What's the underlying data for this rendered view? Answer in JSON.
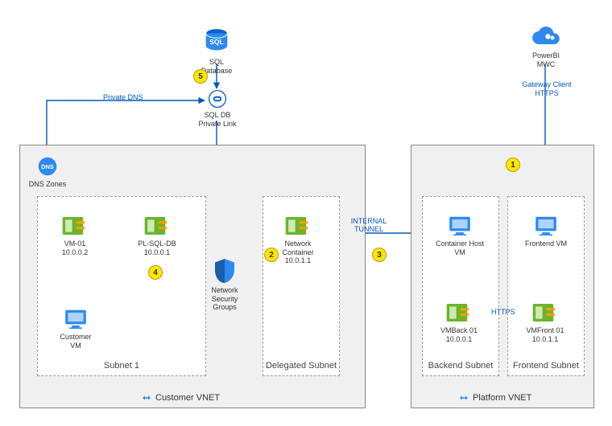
{
  "chart_data": {
    "type": "diagram",
    "title": "",
    "vnets": [
      {
        "name": "Customer VNET",
        "subnets": [
          {
            "name": "Subnet 1",
            "resources": [
              {
                "id": "vm01",
                "label": "VM-01",
                "ip": "10.0.0.2",
                "type": "nic"
              },
              {
                "id": "plsqldb",
                "label": "PL-SQL-DB",
                "ip": "10.0.0.1",
                "type": "nic"
              },
              {
                "id": "customervm",
                "label": "Customer VM",
                "type": "vm"
              }
            ]
          },
          {
            "name": "Delegated Subnet",
            "resources": [
              {
                "id": "netcontainer",
                "label": "Network Container",
                "ip": "10.0.1.1",
                "type": "nic"
              }
            ]
          }
        ],
        "extras": [
          {
            "id": "dns",
            "label": "DNS Zones",
            "type": "dns"
          },
          {
            "id": "nsg",
            "label": "Network Security Groups",
            "type": "nsg"
          }
        ]
      },
      {
        "name": "Platform VNET",
        "subnets": [
          {
            "name": "Backend Subnet",
            "resources": [
              {
                "id": "chost",
                "label": "Container Host VM",
                "type": "vm"
              },
              {
                "id": "vmback",
                "label": "VMBack 01",
                "ip": "10.0.0.1",
                "type": "nic"
              }
            ]
          },
          {
            "name": "Frontend Subnet",
            "resources": [
              {
                "id": "fvm",
                "label": "Frontend VM",
                "type": "vm"
              },
              {
                "id": "vmfront",
                "label": "VMFront 01",
                "ip": "10.0.1.1",
                "type": "nic"
              }
            ]
          }
        ]
      }
    ],
    "external": [
      {
        "id": "sqldb",
        "label": "SQL Database",
        "type": "sql"
      },
      {
        "id": "sqlpl",
        "label": "SQL DB Private Link",
        "type": "privatelink"
      },
      {
        "id": "pbi",
        "label": "PowerBI MWC",
        "type": "cloud"
      }
    ],
    "connections": [
      {
        "from": "pbi",
        "to": "fvm",
        "label": "Gateway Client HTTPS"
      },
      {
        "from": "netcontainer",
        "to": "chost",
        "label": "INTERNAL TUNNEL"
      },
      {
        "from": "vmfront",
        "to": "vmback",
        "label": "HTTPS"
      },
      {
        "from": "dns",
        "to": "sqlpl",
        "label": "Private DNS"
      },
      {
        "from": "dns",
        "to": "plsqldb",
        "label": ""
      },
      {
        "from": "vm01",
        "to": "customervm",
        "label": ""
      },
      {
        "from": "sqldb",
        "to": "sqlpl",
        "label": ""
      },
      {
        "from": "sqlpl",
        "to": "nsg_through",
        "label": ""
      },
      {
        "from": "nsg",
        "to": "plsqldb",
        "label": ""
      },
      {
        "from": "fvm",
        "to": "vmfront",
        "label": ""
      },
      {
        "from": "chost",
        "to": "vmback",
        "label": ""
      }
    ],
    "steps": [
      {
        "n": 1,
        "near": "Gateway Client HTTPS"
      },
      {
        "n": 2,
        "near": "Network Container"
      },
      {
        "n": 3,
        "near": "INTERNAL TUNNEL"
      },
      {
        "n": 4,
        "near": "PL-SQL-DB"
      },
      {
        "n": 5,
        "near": "SQL Database"
      }
    ]
  },
  "labels": {
    "customer_vnet": "Customer VNET",
    "platform_vnet": "Platform VNET",
    "subnet1": "Subnet 1",
    "delegated": "Delegated Subnet",
    "backend": "Backend Subnet",
    "frontend": "Frontend Subnet",
    "sqldb": "SQL Database",
    "sqlpl": "SQL DB Private Link",
    "pbi": "PowerBI MWC",
    "dns": "DNS Zones",
    "nsg": "Network Security Groups",
    "vm01": "VM-01",
    "vm01_ip": "10.0.0.2",
    "customervm": "Customer VM",
    "plsqldb": "PL-SQL-DB",
    "plsqldb_ip": "10.0.0.1",
    "netcontainer": "Network Container",
    "netcontainer_ip": "10.0.1.1",
    "chost": "Container Host VM",
    "fvm": "Frontend VM",
    "vmback": "VMBack 01",
    "vmback_ip": "10.0.0.1",
    "vmfront": "VMFront 01",
    "vmfront_ip": "10.0.1.1",
    "private_dns": "Private DNS",
    "internal_tunnel": "INTERNAL TUNNEL",
    "https": "HTTPS",
    "gateway": "Gateway Client HTTPS"
  },
  "markers": {
    "m1": "1",
    "m2": "2",
    "m3": "3",
    "m4": "4",
    "m5": "5"
  }
}
